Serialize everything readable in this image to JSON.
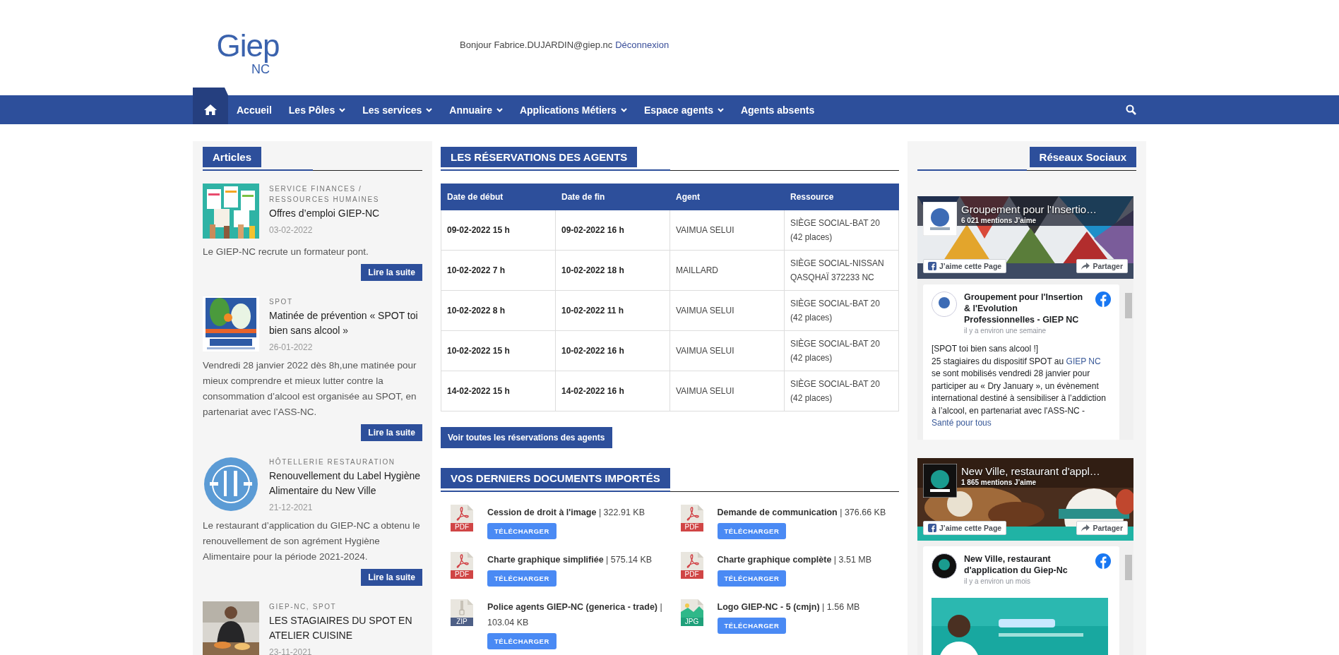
{
  "header": {
    "logo": {
      "main": "Giep",
      "sub": "NC"
    },
    "greeting": "Bonjour Fabrice.DUJARDIN@giep.nc",
    "logout_link": "Déconnexion"
  },
  "nav": {
    "items": [
      {
        "kind": "home",
        "selected": true
      },
      {
        "kind": "link",
        "label": "Accueil",
        "dropdown": false,
        "selected": false
      },
      {
        "kind": "link",
        "label": "Les Pôles",
        "dropdown": true,
        "selected": false
      },
      {
        "kind": "link",
        "label": "Les services",
        "dropdown": true,
        "selected": false
      },
      {
        "kind": "link",
        "label": "Annuaire",
        "dropdown": true,
        "selected": false
      },
      {
        "kind": "link",
        "label": "Applications Métiers",
        "dropdown": true,
        "selected": false
      },
      {
        "kind": "link",
        "label": "Espace agents",
        "dropdown": true,
        "selected": false
      },
      {
        "kind": "link",
        "label": "Agents absents",
        "dropdown": false,
        "selected": false
      }
    ]
  },
  "articles": {
    "title": "Articles",
    "items": [
      {
        "category": "SERVICE FINANCES / RESSOURCES HUMAINES",
        "title": "Offres d’emploi GIEP-NC",
        "date": "03-02-2022",
        "summary": "Le GIEP-NC recrute un formateur pont.",
        "button": "Lire la suite"
      },
      {
        "category": "SPOT",
        "title": "Matinée de prévention « SPOT toi bien sans alcool »",
        "date": "26-01-2022",
        "summary": "Vendredi 28 janvier 2022 dès 8h,une matinée pour mieux comprendre et mieux lutter contre la consommation d’alcool est organisée au SPOT, en partenariat avec l’ASS-NC.",
        "button": "Lire la suite"
      },
      {
        "category": "HÔTELLERIE RESTAURATION",
        "title": "Renouvellement du Label Hygiène Alimentaire du New Ville",
        "date": "21-12-2021",
        "summary": "Le restaurant d’application du GIEP-NC a obtenu le renouvellement de son agrément Hygiène Alimentaire pour la période 2021-2024.",
        "button": "Lire la suite"
      },
      {
        "category": "GIEP-NC, SPOT",
        "title": "LES STAGIAIRES DU SPOT EN ATELIER CUISINE",
        "date": "23-11-2021"
      }
    ]
  },
  "reservations": {
    "title": "LES RÉSERVATIONS DES AGENTS",
    "columns": [
      "Date de début",
      "Date de fin",
      "Agent",
      "Ressource"
    ],
    "rows": [
      [
        "09-02-2022 15 h",
        "09-02-2022 16 h",
        "VAIMUA SELUI",
        "SIÈGE SOCIAL-BAT 20 (42 places)"
      ],
      [
        "10-02-2022 7 h",
        "10-02-2022 18 h",
        "MAILLARD",
        "SIÈGE SOCIAL-NISSAN QASQHAÏ 372233 NC"
      ],
      [
        "10-02-2022 8 h",
        "10-02-2022 11 h",
        "VAIMUA SELUI",
        "SIÈGE SOCIAL-BAT 20 (42 places)"
      ],
      [
        "10-02-2022 15 h",
        "10-02-2022 16 h",
        "VAIMUA SELUI",
        "SIÈGE SOCIAL-BAT 20 (42 places)"
      ],
      [
        "14-02-2022 15 h",
        "14-02-2022 16 h",
        "VAIMUA SELUI",
        "SIÈGE SOCIAL-BAT 20 (42 places)"
      ]
    ],
    "button": "Voir toutes les réservations des agents"
  },
  "documents": {
    "title": "VOS DERNIERS DOCUMENTS IMPORTÉS",
    "items": [
      {
        "kind": "pdf",
        "badge": "PDF",
        "name": "Cession de droit à l'image",
        "separator": "|",
        "size": "322.91 KB",
        "button": "TÉLÉCHARGER"
      },
      {
        "kind": "pdf",
        "badge": "PDF",
        "name": "Demande de communication",
        "separator": "|",
        "size": "376.66 KB",
        "button": "TÉLÉCHARGER"
      },
      {
        "kind": "pdf",
        "badge": "PDF",
        "name": "Charte graphique simplifiée",
        "separator": "|",
        "size": "575.14 KB",
        "button": "TÉLÉCHARGER"
      },
      {
        "kind": "pdf",
        "badge": "PDF",
        "name": "Charte graphique complète",
        "separator": "|",
        "size": "3.51 MB",
        "button": "TÉLÉCHARGER"
      },
      {
        "kind": "zip",
        "badge": "ZIP",
        "name": "Police agents GIEP-NC (generica - trade)",
        "separator": "|",
        "size": "103.04 KB",
        "button": "TÉLÉCHARGER"
      },
      {
        "kind": "jpg",
        "badge": "JPG",
        "name": "Logo GIEP-NC - 5 (cmjn)",
        "separator": "|",
        "size": "1.56 MB",
        "button": "TÉLÉCHARGER"
      }
    ]
  },
  "social": {
    "title": "Réseaux Sociaux",
    "pages": [
      {
        "name": "Groupement pour l'Insertio…",
        "likes": "6 021 mentions J’aime",
        "like_button": "J’aime cette Page",
        "share_button": "Partager",
        "post": {
          "author": "Groupement pour l'Insertion & l'Evolution Professionnelles - GIEP NC",
          "time": "il y a environ une semaine",
          "body": [
            {
              "kind": "text",
              "text": "[SPOT toi bien sans alcool !]\n25 stagiaires du dispositif SPOT au "
            },
            {
              "kind": "link",
              "text": "GIEP NC"
            },
            {
              "kind": "text",
              "text": " se sont mobilisés vendredi 28 janvier pour participer au « Dry January », un évènement international destiné à sensibiliser à l’addiction à l’alcool, en partenariat avec l'ASS-NC - "
            },
            {
              "kind": "link",
              "text": "Santé pour tous"
            }
          ]
        }
      },
      {
        "name": "New Ville, restaurant d'appl…",
        "likes": "1 865 mentions J’aime",
        "like_button": "J’aime cette Page",
        "share_button": "Partager",
        "post": {
          "author": "New Ville, restaurant d'application du Giep-Nc",
          "time": "il y a environ un mois"
        }
      }
    ]
  }
}
